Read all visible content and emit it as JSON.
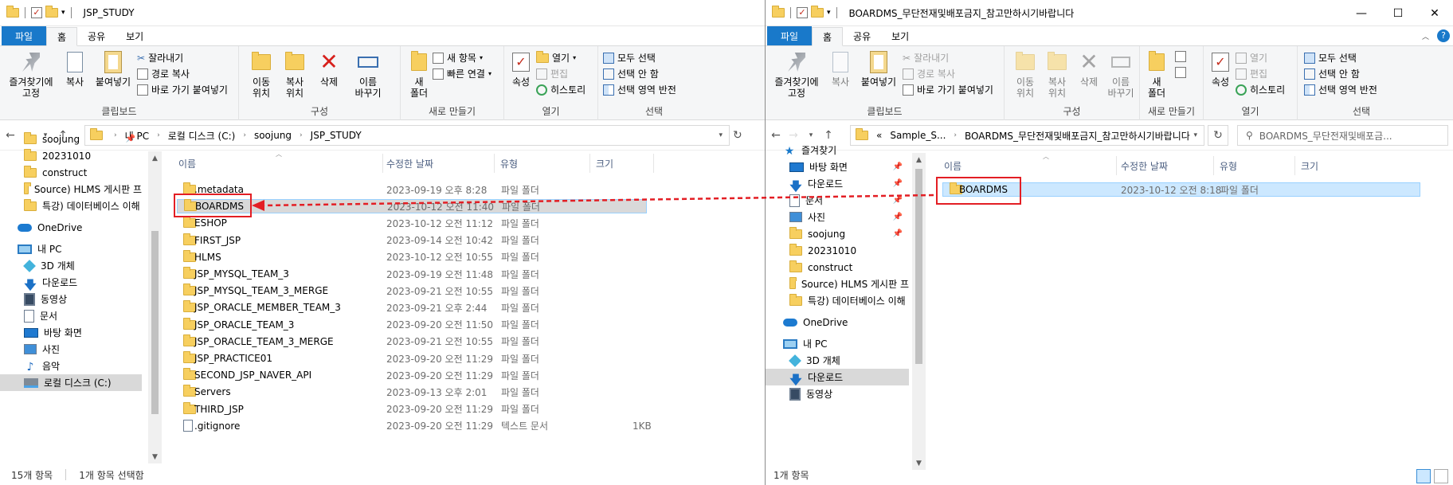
{
  "left": {
    "title": "JSP_STUDY",
    "tabs": {
      "file": "파일",
      "home": "홈",
      "share": "공유",
      "view": "보기"
    },
    "ribbon": {
      "pin_quick": "즐겨찾기에\n고정",
      "copy": "복사",
      "paste": "붙여넣기",
      "cut": "잘라내기",
      "copy_path": "경로 복사",
      "paste_shortcut": "바로 가기 붙여넣기",
      "move_to": "이동\n위치",
      "copy_to": "복사\n위치",
      "delete": "삭제",
      "rename": "이름\n바꾸기",
      "new_folder": "새\n폴더",
      "new_item": "새 항목",
      "easy_access": "빠른 연결",
      "properties": "속성",
      "open": "열기",
      "edit": "편집",
      "history": "히스토리",
      "select_all": "모두 선택",
      "select_none": "선택 안 함",
      "invert_selection": "선택 영역 반전",
      "groups": {
        "clipboard": "클립보드",
        "organize": "구성",
        "new": "새로 만들기",
        "open": "열기",
        "select": "선택"
      }
    },
    "address": {
      "crumbs": [
        "내 PC",
        "로컬 디스크 (C:)",
        "soojung",
        "JSP_STUDY"
      ]
    },
    "nav_items": [
      {
        "label": "soojung",
        "icon": "folder-icon",
        "pinned": true
      },
      {
        "label": "20231010",
        "icon": "folder-icon"
      },
      {
        "label": "construct",
        "icon": "folder-icon"
      },
      {
        "label": "Source) HLMS 게시판 프",
        "icon": "folder-icon"
      },
      {
        "label": "특강) 데이터베이스 이해",
        "icon": "folder-icon"
      },
      {
        "label": "OneDrive",
        "icon": "onedrive-icon"
      },
      {
        "label": "내 PC",
        "icon": "pc-icon"
      },
      {
        "label": "3D 개체",
        "icon": "3d-objects-icon"
      },
      {
        "label": "다운로드",
        "icon": "download-icon"
      },
      {
        "label": "동영상",
        "icon": "video-icon"
      },
      {
        "label": "문서",
        "icon": "documents-icon"
      },
      {
        "label": "바탕 화면",
        "icon": "desktop-icon"
      },
      {
        "label": "사진",
        "icon": "pictures-icon"
      },
      {
        "label": "음악",
        "icon": "music-icon"
      },
      {
        "label": "로컬 디스크 (C:)",
        "icon": "drive-icon",
        "selected": true
      }
    ],
    "columns": {
      "name": "이름",
      "date": "수정한 날짜",
      "type": "유형",
      "size": "크기"
    },
    "files": [
      {
        "name": ".metadata",
        "date": "2023-09-19 오후 8:28",
        "type": "파일 폴더",
        "size": ""
      },
      {
        "name": "BOARDMS",
        "date": "2023-10-12 오전 11:40",
        "type": "파일 폴더",
        "size": ""
      },
      {
        "name": "ESHOP",
        "date": "2023-10-12 오전 11:12",
        "type": "파일 폴더",
        "size": ""
      },
      {
        "name": "FIRST_JSP",
        "date": "2023-09-14 오전 10:42",
        "type": "파일 폴더",
        "size": ""
      },
      {
        "name": "HLMS",
        "date": "2023-10-12 오전 10:55",
        "type": "파일 폴더",
        "size": ""
      },
      {
        "name": "JSP_MYSQL_TEAM_3",
        "date": "2023-09-19 오전 11:48",
        "type": "파일 폴더",
        "size": ""
      },
      {
        "name": "JSP_MYSQL_TEAM_3_MERGE",
        "date": "2023-09-21 오전 10:55",
        "type": "파일 폴더",
        "size": ""
      },
      {
        "name": "JSP_ORACLE_MEMBER_TEAM_3",
        "date": "2023-09-21 오후 2:44",
        "type": "파일 폴더",
        "size": ""
      },
      {
        "name": "JSP_ORACLE_TEAM_3",
        "date": "2023-09-20 오전 11:50",
        "type": "파일 폴더",
        "size": ""
      },
      {
        "name": "JSP_ORACLE_TEAM_3_MERGE",
        "date": "2023-09-21 오전 10:55",
        "type": "파일 폴더",
        "size": ""
      },
      {
        "name": "JSP_PRACTICE01",
        "date": "2023-09-20 오전 11:29",
        "type": "파일 폴더",
        "size": ""
      },
      {
        "name": "SECOND_JSP_NAVER_API",
        "date": "2023-09-20 오전 11:29",
        "type": "파일 폴더",
        "size": ""
      },
      {
        "name": "Servers",
        "date": "2023-09-13 오후 2:01",
        "type": "파일 폴더",
        "size": ""
      },
      {
        "name": "THIRD_JSP",
        "date": "2023-09-20 오전 11:29",
        "type": "파일 폴더",
        "size": ""
      },
      {
        "name": ".gitignore",
        "date": "2023-09-20 오전 11:29",
        "type": "텍스트 문서",
        "size": "1KB"
      }
    ],
    "status": {
      "count": "15개 항목",
      "selected": "1개 항목 선택함"
    }
  },
  "right": {
    "title": "BOARDMS_무단전재및배포금지_참고만하시기바랍니다",
    "tabs": {
      "file": "파일",
      "home": "홈",
      "share": "공유",
      "view": "보기"
    },
    "address": {
      "crumbs": [
        "«",
        "Sample_S...",
        "BOARDMS_무단전재및배포금지_참고만하시기바랍니다"
      ]
    },
    "search": {
      "placeholder": "BOARDMS_무단전재및배포금..."
    },
    "nav_items": [
      {
        "label": "즐겨찾기",
        "icon": "star-icon"
      },
      {
        "label": "바탕 화면",
        "icon": "desktop-icon",
        "pinned": true
      },
      {
        "label": "다운로드",
        "icon": "download-icon",
        "pinned": true
      },
      {
        "label": "문서",
        "icon": "documents-icon",
        "pinned": true
      },
      {
        "label": "사진",
        "icon": "pictures-icon",
        "pinned": true
      },
      {
        "label": "soojung",
        "icon": "folder-icon",
        "pinned": true
      },
      {
        "label": "20231010",
        "icon": "folder-icon"
      },
      {
        "label": "construct",
        "icon": "folder-icon"
      },
      {
        "label": "Source) HLMS 게시판 프",
        "icon": "folder-icon"
      },
      {
        "label": "특강) 데이터베이스 이해",
        "icon": "folder-icon"
      },
      {
        "label": "OneDrive",
        "icon": "onedrive-icon"
      },
      {
        "label": "내 PC",
        "icon": "pc-icon"
      },
      {
        "label": "3D 개체",
        "icon": "3d-objects-icon"
      },
      {
        "label": "다운로드",
        "icon": "download-icon",
        "selected": true
      },
      {
        "label": "동영상",
        "icon": "video-icon"
      }
    ],
    "columns": {
      "name": "이름",
      "date": "수정한 날짜",
      "type": "유형",
      "size": "크기"
    },
    "files": [
      {
        "name": "BOARDMS",
        "date": "2023-10-12 오전 8:18",
        "type": "파일 폴더"
      }
    ],
    "status": {
      "count": "1개 항목"
    }
  },
  "colors": {
    "accent": "#1979ca",
    "highlight": "#e31e24"
  }
}
